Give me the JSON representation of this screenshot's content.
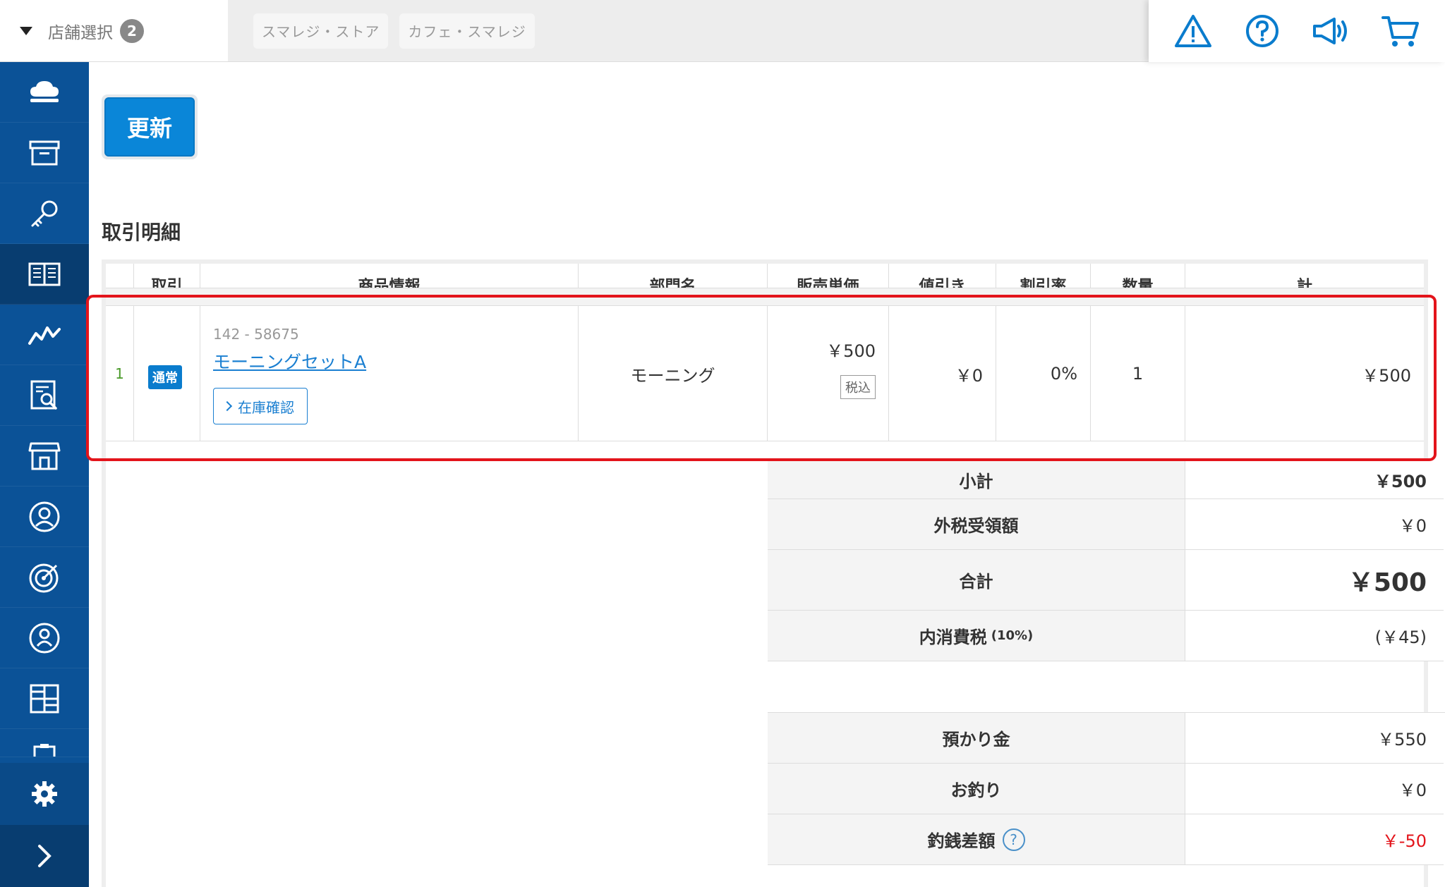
{
  "topbar": {
    "store_select_label": "店舗選択",
    "store_count": "2",
    "store_tabs": [
      "スマレジ・ストア",
      "カフェ・スマレジ"
    ],
    "icons": [
      "warning-icon",
      "help-icon",
      "megaphone-icon",
      "cart-icon"
    ]
  },
  "sidebar": {
    "items": [
      "cloud-icon",
      "archive-icon",
      "key-icon",
      "book-icon",
      "chart-line-icon",
      "report-search-icon",
      "store-icon",
      "user-circle-icon",
      "target-icon",
      "member-icon",
      "grid-icon",
      "clipboard-icon"
    ],
    "active_index": 3,
    "settings": "gear-icon",
    "expand": "chevron-right-icon"
  },
  "main": {
    "refresh_label": "更新",
    "section_title": "取引明細",
    "columns": [
      "取引",
      "商品情報",
      "部門名",
      "販売単価",
      "値引き",
      "割引率",
      "数量",
      "計"
    ],
    "row": {
      "no": "1",
      "type": "通常",
      "code": "142 - 58675",
      "name": "モーニングセットA",
      "stock_label": "在庫確認",
      "dept": "モーニング",
      "price": "￥500",
      "tax_tag": "税込",
      "discount": "￥0",
      "rate": "0%",
      "qty": "1",
      "total": "￥500"
    },
    "summary": {
      "subtotal_label": "小計",
      "subtotal": "￥500",
      "ext_tax_label": "外税受領額",
      "ext_tax": "￥0",
      "total_label": "合計",
      "total": "￥500",
      "inc_tax_label": "内消費税",
      "inc_tax_rate": "(10%)",
      "inc_tax": "(￥45)",
      "deposit_label": "預かり金",
      "deposit": "￥550",
      "change_label": "お釣り",
      "change": "￥0",
      "diff_label": "釣銭差額",
      "diff": "￥-50"
    }
  },
  "colors": {
    "sidebar": "#0b5297",
    "accent": "#0a86d8",
    "highlight": "#e3141b"
  }
}
